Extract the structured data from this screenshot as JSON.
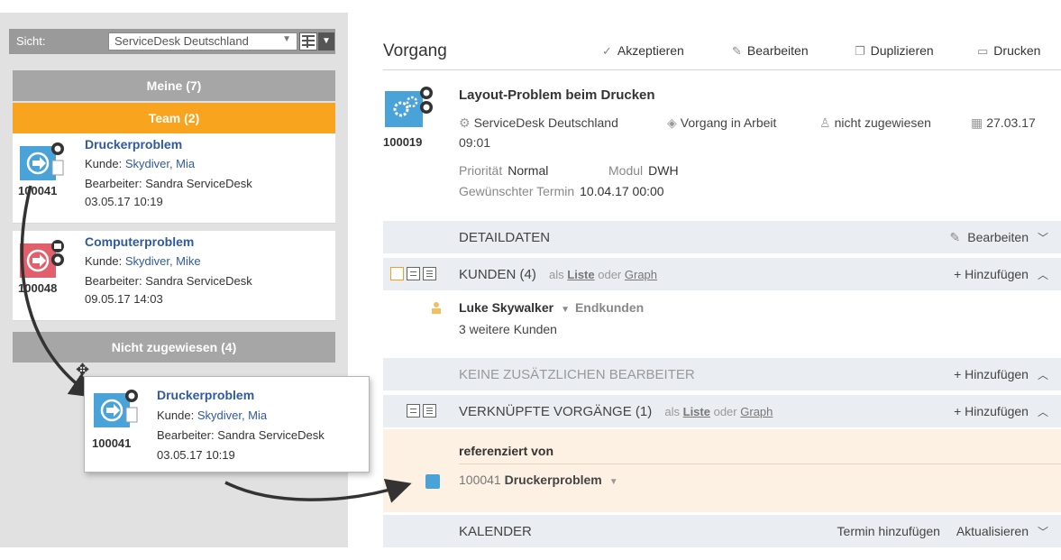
{
  "view": {
    "label": "Sicht:",
    "selected": "ServiceDesk Deutschland"
  },
  "groups": {
    "meine": "Meine (7)",
    "team": "Team (2)",
    "nicht": "Nicht zugewiesen (4)"
  },
  "tickets": [
    {
      "number": "100041",
      "title": "Druckerproblem",
      "kunde_label": "Kunde:",
      "kunde": "Skydiver, Mia",
      "bearbeiter": "Bearbeiter: Sandra ServiceDesk",
      "date": "03.05.17 10:19"
    },
    {
      "number": "100048",
      "title": "Computerproblem",
      "kunde_label": "Kunde:",
      "kunde": "Skydiver, Mike",
      "bearbeiter": "Bearbeiter: Sandra ServiceDesk",
      "date": "09.05.17 14:03"
    }
  ],
  "drag_ticket": {
    "number": "100041",
    "title": "Druckerproblem",
    "kunde_label": "Kunde:",
    "kunde": "Skydiver, Mia",
    "bearbeiter": "Bearbeiter: Sandra ServiceDesk",
    "date": "03.05.17 10:19"
  },
  "vorgang": {
    "heading": "Vorgang",
    "actions": {
      "akzeptieren": "Akzeptieren",
      "bearbeiten": "Bearbeiten",
      "duplizieren": "Duplizieren",
      "drucken": "Drucken"
    },
    "number": "100019",
    "title": "Layout-Problem beim Drucken",
    "team": "ServiceDesk Deutschland",
    "status": "Vorgang in Arbeit",
    "assignee": "nicht zugewiesen",
    "date_part1": "27.03.17",
    "date_part2": "09:01",
    "prioritaet_label": "Priorität",
    "prioritaet": "Normal",
    "modul_label": "Modul",
    "modul": "DWH",
    "termin_label": "Gewünschter Termin",
    "termin": "10.04.17 00:00"
  },
  "sections": {
    "detaildaten": {
      "title": "DETAILDATEN",
      "action": "Bearbeiten"
    },
    "kunden": {
      "title": "KUNDEN (4)",
      "als": "als",
      "liste": "Liste",
      "oder": "oder",
      "graph": "Graph",
      "action": "+ Hinzufügen"
    },
    "keine": {
      "title": "KEINE ZUSÄTZLICHEN BEARBEITER",
      "action": "+ Hinzufügen"
    },
    "verknuepfte": {
      "title": "VERKNÜPFTE VORGÄNGE (1)",
      "als": "als",
      "liste": "Liste",
      "oder": "oder",
      "graph": "Graph",
      "action": "+ Hinzufügen"
    },
    "kalender": {
      "title": "KALENDER",
      "action1": "Termin hinzufügen",
      "action2": "Aktualisieren"
    }
  },
  "kunden_list": {
    "person": "Luke Skywalker",
    "role": "Endkunden",
    "more": "3 weitere Kunden"
  },
  "referenced": {
    "title": "referenziert von",
    "number": "100041",
    "name": "Druckerproblem"
  },
  "colors": {
    "team_orange": "#f8a41f",
    "link_blue": "#2f5a9e",
    "icon_blue": "#4aa3d8",
    "icon_red": "#e2606b",
    "ref_bg": "#fdf1e3"
  }
}
